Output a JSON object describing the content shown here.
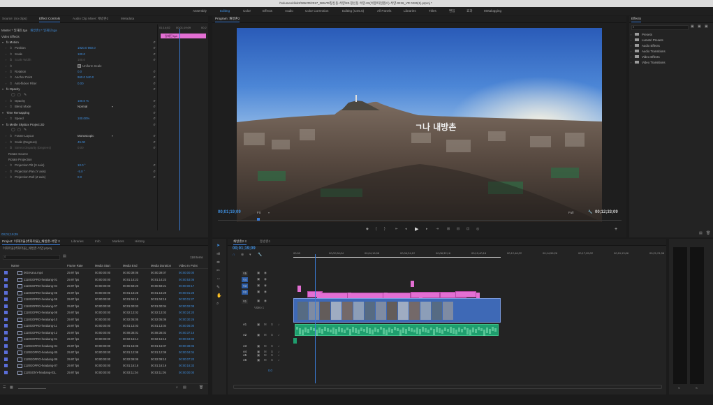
{
  "window": {
    "path": "/Volumes/disk3/365VR/2017_365VR/창신동-석양/20-창신동 석양-01(석양/타임랩스)-석양-0226_VR 0226(1).prproj *"
  },
  "workspaces": [
    "Assembly",
    "Editing",
    "Color",
    "Effects",
    "Audio",
    "Color Correction",
    "Editing (CS5.5)",
    "All Panels",
    "Libraries",
    "Titles",
    "편집",
    "효과",
    "Metalogging"
  ],
  "workspace_active": "Editing",
  "source_panel": {
    "tabs": [
      "Source: (no clips)",
      "Effect Controls",
      "Audio Clip Mixer: 채방촌2",
      "Metadata"
    ],
    "active_tab": "Effect Controls",
    "master_label": "Master * 일재진.tga",
    "clip_label": "채방촌2 * 일재진.tga",
    "timecodes": [
      "01;14;02",
      "00;01;19;09",
      "00;2"
    ],
    "clip_name": "일재진.tga",
    "section": "Video Effects",
    "rows": [
      {
        "label": "fx  Motion",
        "value": "",
        "kind": "group"
      },
      {
        "label": "Position",
        "value": "1920.0   960.0",
        "kind": "param"
      },
      {
        "label": "Scale",
        "value": "100.0",
        "kind": "param"
      },
      {
        "label": "Scale Width",
        "value": "100.0",
        "kind": "dim"
      },
      {
        "label": "Uniform Scale",
        "value": "",
        "kind": "check"
      },
      {
        "label": "Rotation",
        "value": "0.0",
        "kind": "param"
      },
      {
        "label": "Anchor Point",
        "value": "960.0   540.0",
        "kind": "param"
      },
      {
        "label": "Anti-flicker Filter",
        "value": "0.00",
        "kind": "param"
      },
      {
        "label": "fx  Opacity",
        "value": "",
        "kind": "group"
      },
      {
        "label": "",
        "value": "",
        "kind": "shapes"
      },
      {
        "label": "Opacity",
        "value": "100.0 %",
        "kind": "param"
      },
      {
        "label": "Blend Mode",
        "value": "Normal",
        "kind": "select"
      },
      {
        "label": "Time Remapping",
        "value": "",
        "kind": "group"
      },
      {
        "label": "Speed",
        "value": "100.00%",
        "kind": "param"
      },
      {
        "label": "fx  Mettle SkyBox Project 2D",
        "value": "",
        "kind": "group"
      },
      {
        "label": "",
        "value": "",
        "kind": "shapes"
      },
      {
        "label": "Frame Layout",
        "value": "Monoscopic",
        "kind": "select"
      },
      {
        "label": "Scale (Degrees)",
        "value": "45.00",
        "kind": "param"
      },
      {
        "label": "Stereo Disparity (Degrees)",
        "value": "0.00",
        "kind": "dim"
      },
      {
        "label": "Rotate Source",
        "value": "",
        "kind": "sub"
      },
      {
        "label": "Rotate Projection",
        "value": "",
        "kind": "sub"
      },
      {
        "label": "Projection Tilt (X axis)",
        "value": "10.0 °",
        "kind": "param"
      },
      {
        "label": "Projection Pan (Y axis)",
        "value": "-5.0 °",
        "kind": "param"
      },
      {
        "label": "Projection Roll (Z axis)",
        "value": "0.0",
        "kind": "param"
      }
    ],
    "footer_timecode": "00;01;19;09"
  },
  "program": {
    "tab": "Program: 채방촌2",
    "timecode": "00;01;19;09",
    "fit": "Fit",
    "quality": "Full",
    "duration": "00;12;33;09",
    "overlay_text": "ㄱ나 내방촌"
  },
  "effects_panel": {
    "title": "Effects",
    "items": [
      "Presets",
      "Lumetri Presets",
      "Audio Effects",
      "Audio Transitions",
      "Video Effects",
      "Video Transitions"
    ]
  },
  "project": {
    "tabs": [
      "Project: 이화마을(벽화마을)_채방촌-석양 ≡",
      "Libraries",
      "Info",
      "Markers",
      "History"
    ],
    "active_tab": "Project: 이화마을(벽화마을)_채방촌-석양 ≡",
    "path": "이화마을(벽화마을)_채방촌-석양.prproj",
    "count": "118 Items",
    "columns": [
      "Name",
      "Frame Rate",
      "Media Start",
      "Media End",
      "Media Duration",
      "Video In Point"
    ],
    "rows": [
      [
        "000.Kana.mp4",
        "29.97 fps",
        "00:00:00:00",
        "00:00:39:06",
        "00:00:39:07",
        "00:00:00:00"
      ],
      [
        "1118GOPRO-heabang-01",
        "29.97 fps",
        "00:00:00:00",
        "00:01:14:22",
        "00:01:14:23",
        "00:00:53:06"
      ],
      [
        "1118GOPRO-heabang-04",
        "29.97 fps",
        "00:00:00:00",
        "00:00:59:20",
        "00:00:59:21",
        "00:00:00:17"
      ],
      [
        "1118GOPRO-heabang-05",
        "29.97 fps",
        "00:00:00:00",
        "00:01:16:28",
        "00:01:16:29",
        "00:00:01:28"
      ],
      [
        "1118GOPRO-heabang-06",
        "29.97 fps",
        "00:00:00:00",
        "00:01:04:18",
        "00:01:04:19",
        "00:00:01:27"
      ],
      [
        "1118GOPRO-heabang-07",
        "29.97 fps",
        "00:00:00:00",
        "00:01:00:03",
        "00:01:00:04",
        "00:00:02:08"
      ],
      [
        "1118GOPRO-heabang-08",
        "29.97 fps",
        "00:00:00:00",
        "00:02:13:02",
        "00:02:13:03",
        "00:00:24:20"
      ],
      [
        "1118GOPRO-heabang-10",
        "29.97 fps",
        "00:00:00:00",
        "00:02:05:05",
        "00:02:05:06",
        "00:00:30:26"
      ],
      [
        "1118GOPRO-heabang-11",
        "29.97 fps",
        "00:00:00:00",
        "00:01:13:03",
        "00:01:13:04",
        "00:00:06:00"
      ],
      [
        "1118GOPRO-heabang-12",
        "29.97 fps",
        "00:00:00:00",
        "00:08:36:01",
        "00:08:36:02",
        "00:00:37:16"
      ],
      [
        "1118GOPRO-heabang-01",
        "29.97 fps",
        "00:00:00:00",
        "00:02:15:14",
        "00:02:15:15",
        "00:00:04:03"
      ],
      [
        "1120GOPRO-heabang-04",
        "29.97 fps",
        "00:00:00:00",
        "00:01:15:06",
        "00:01:15:07",
        "00:00:38:05"
      ],
      [
        "1120GOPRO-heabang-05",
        "29.97 fps",
        "00:00:00:00",
        "00:01:12:08",
        "00:01:12:09",
        "00:00:04:04"
      ],
      [
        "1120GOPRO-heabang-06",
        "29.97 fps",
        "00:00:00:00",
        "00:02:09:09",
        "00:02:09:10",
        "00:00:07:20"
      ],
      [
        "1120GOPRO-heabang-07",
        "29.97 fps",
        "00:00:00:00",
        "00:01:16:18",
        "00:01:16:19",
        "00:00:16:33"
      ],
      [
        "1120SONY-heabang-01L",
        "29.97 fps",
        "00:00:00:00",
        "00:03:11:04",
        "00:03:11:05",
        "00:00:00:00"
      ]
    ]
  },
  "timeline": {
    "tabs": [
      "채방촌2 ≡",
      "동방촌1"
    ],
    "timecode": "00;01;19;09",
    "ruler": [
      "00:00",
      "00;02;08;04",
      "00;04;16;08",
      "00;06;24;12",
      "00;08;32;16",
      "00;10;40;18",
      "00;12;48;22",
      "00;14;56;26",
      "00;17;05;02",
      "00;19;13;06",
      "00;21;21;08"
    ],
    "video_tracks": [
      "V5",
      "V4",
      "V3",
      "V2",
      "V1"
    ],
    "v1_name": "Video 1",
    "audio_tracks": [
      "A1",
      "A2",
      "A3",
      "A4",
      "A5",
      "A6"
    ],
    "master": "0.0"
  },
  "meter": {
    "labels": [
      "S",
      "S"
    ]
  },
  "colors": {
    "accent": "#3a7bd5",
    "pink": "#e36fd3",
    "audio": "#1f9e6e",
    "bg": "#232323"
  }
}
